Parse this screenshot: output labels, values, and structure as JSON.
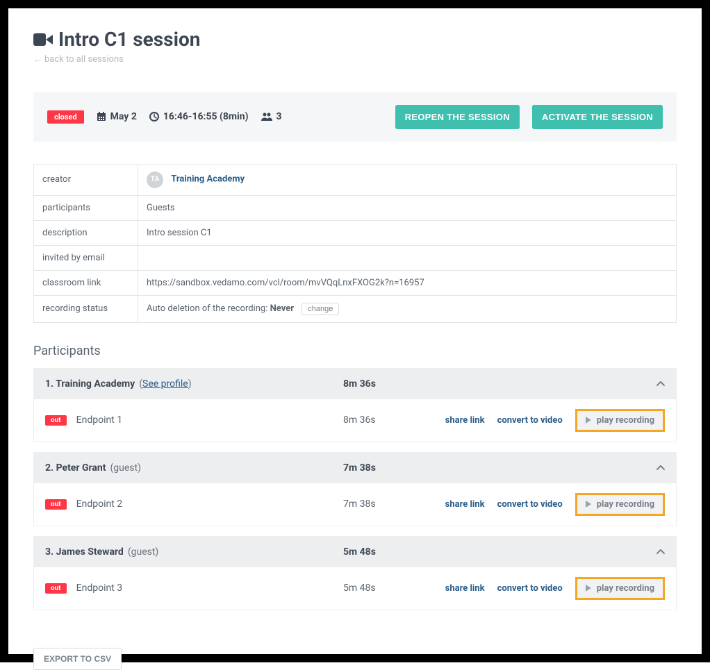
{
  "page": {
    "title": "Intro C1 session",
    "back_link": "back to all sessions"
  },
  "info_bar": {
    "status": "closed",
    "date": "May 2",
    "time": "16:46-16:55 (8min)",
    "participant_count": "3",
    "reopen_btn": "REOPEN THE SESSION",
    "activate_btn": "ACTIVATE THE SESSION"
  },
  "details": {
    "labels": {
      "creator": "creator",
      "participants": "participants",
      "description": "description",
      "invited": "invited by email",
      "link": "classroom link",
      "recording": "recording status"
    },
    "creator_initials": "TA",
    "creator_name": "Training Academy",
    "participants": "Guests",
    "description": "Intro session C1",
    "invited": "",
    "link": "https://sandbox.vedamo.com/vcl/room/mvVQqLnxFXOG2k?n=16957",
    "recording_prefix": "Auto deletion of the recording: ",
    "recording_value": "Never",
    "change_btn": "change"
  },
  "participants_section": {
    "title": "Participants",
    "share_link": "share link",
    "convert": "convert to video",
    "play": "play recording",
    "see_profile": "See profile",
    "out_badge": "out",
    "items": [
      {
        "idx": "1.",
        "name": "Training Academy",
        "tag": "",
        "duration": "8m 36s",
        "endpoint": "Endpoint 1",
        "ep_duration": "8m 36s",
        "has_profile": true
      },
      {
        "idx": "2.",
        "name": "Peter Grant",
        "tag": "(guest)",
        "duration": "7m 38s",
        "endpoint": "Endpoint 2",
        "ep_duration": "7m 38s",
        "has_profile": false
      },
      {
        "idx": "3.",
        "name": "James Steward",
        "tag": "(guest)",
        "duration": "5m 48s",
        "endpoint": "Endpoint 3",
        "ep_duration": "5m 48s",
        "has_profile": false
      }
    ]
  },
  "export_btn": "EXPORT TO CSV"
}
